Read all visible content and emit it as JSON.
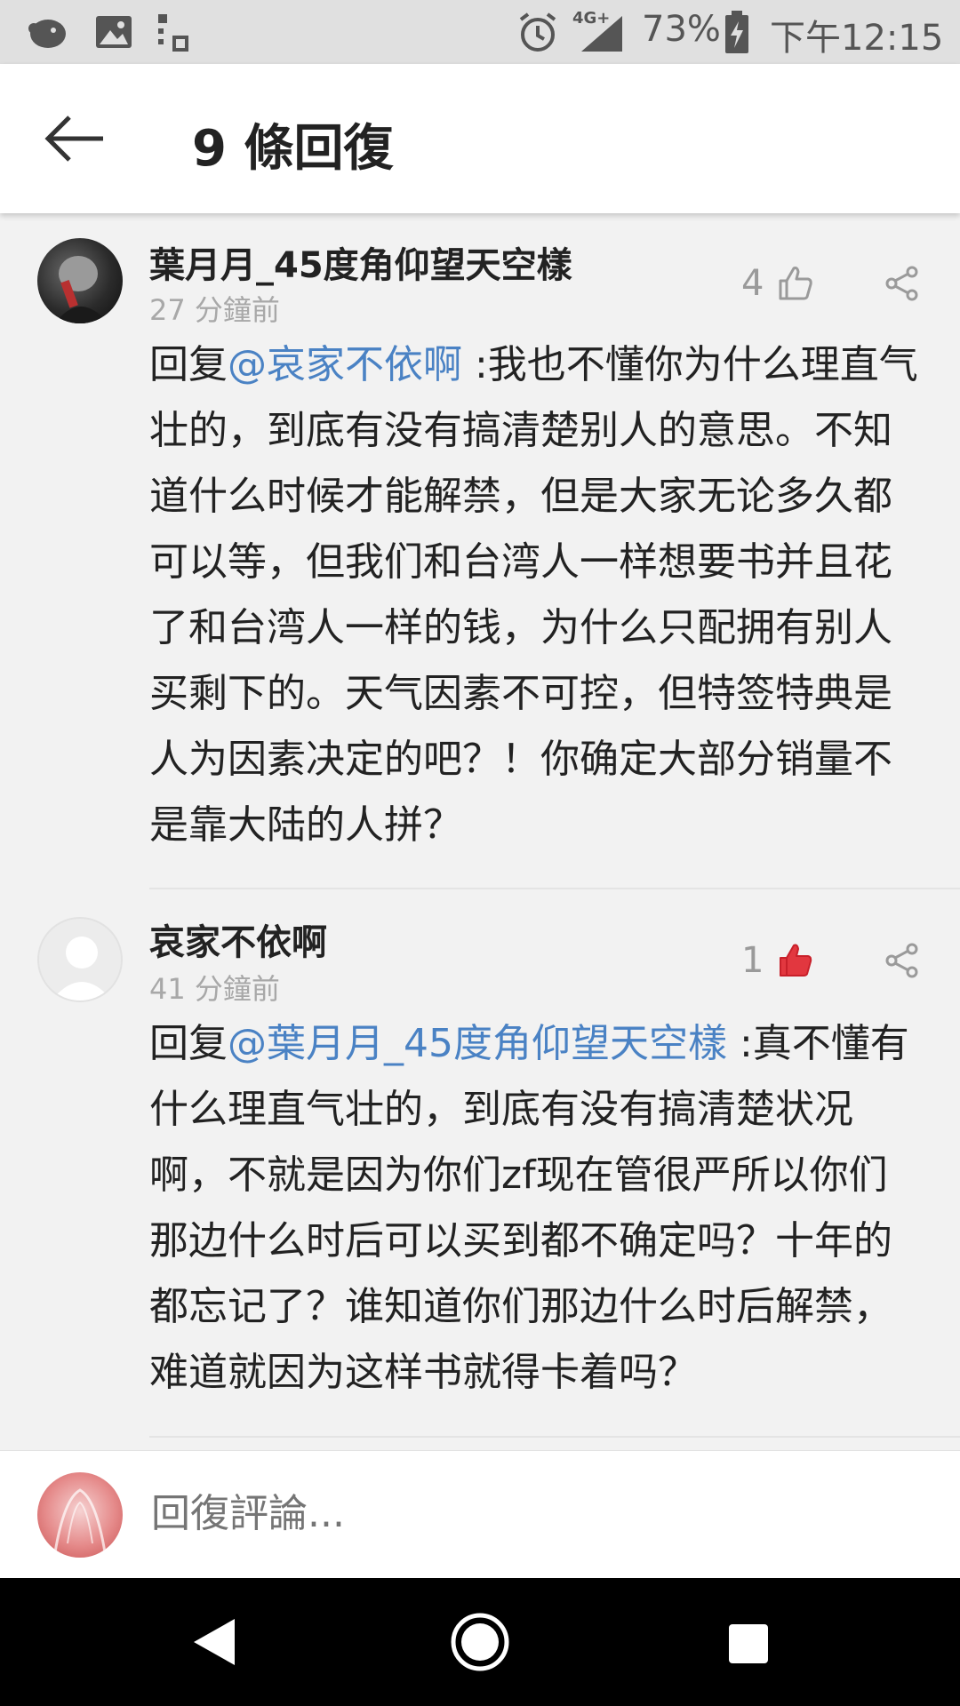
{
  "status_bar": {
    "network": "4G+",
    "battery": "73%",
    "time": "下午12:15"
  },
  "header": {
    "title": "9 條回復",
    "back_icon": "arrow-left-icon"
  },
  "comments": [
    {
      "username": "葉月月_45度角仰望天空樣",
      "timestamp": "27 分鐘前",
      "likes": "4",
      "liked": false,
      "reply_prefix": "回复",
      "mention": "@哀家不依啊",
      "text": " :我也不懂你为什么理直气壮的，到底有没有搞清楚别人的意思。不知道什么时候才能解禁，但是大家无论多久都可以等，但我们和台湾人一样想要书并且花了和台湾人一样的钱，为什么只配拥有别人买剩下的。天气因素不可控，但特签特典是人为因素决定的吧？！你确定大部分销量不是靠大陆的人拼？"
    },
    {
      "username": "哀家不依啊",
      "timestamp": "41 分鐘前",
      "likes": "1",
      "liked": true,
      "reply_prefix": "回复",
      "mention": "@葉月月_45度角仰望天空樣",
      "text": " :真不懂有什么理直气壮的，到底有没有搞清楚状况啊，不就是因为你们zf现在管很严所以你们那边什么时后可以买到都不确定吗？十年的都忘记了？谁知道你们那边什么时后解禁，难道就因为这样书就得卡着吗？"
    }
  ],
  "reply_bar": {
    "placeholder": "回復評論..."
  },
  "colors": {
    "mention": "#4a82c4",
    "liked": "#e2373f",
    "timestamp": "#a8a8a8"
  }
}
